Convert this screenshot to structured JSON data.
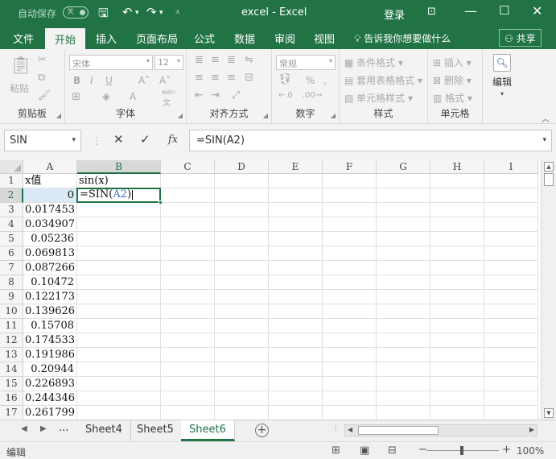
{
  "titlebar": {
    "autosave": "自动保存",
    "autosave_state": "关",
    "title": "excel  -  Excel",
    "login": "登录"
  },
  "tabs": [
    "文件",
    "开始",
    "插入",
    "页面布局",
    "公式",
    "数据",
    "审阅",
    "视图"
  ],
  "active_tab": "开始",
  "tellme": "告诉我你想要做什么",
  "share": "共享",
  "ribbon": {
    "clipboard": {
      "label": "剪贴板",
      "paste": "粘贴"
    },
    "font": {
      "label": "字体",
      "name": "宋体",
      "size": "12",
      "wen": "wén"
    },
    "alignment": {
      "label": "对齐方式"
    },
    "number": {
      "label": "数字",
      "format": "常规"
    },
    "styles": {
      "label": "样式",
      "items": [
        "条件格式",
        "套用表格格式",
        "单元格样式"
      ]
    },
    "cells": {
      "label": "单元格",
      "items": [
        "插入",
        "删除",
        "格式"
      ]
    },
    "editing": {
      "label": "编辑"
    }
  },
  "formula_bar": {
    "name_box": "SIN",
    "formula": "=SIN(A2)"
  },
  "columns": [
    "A",
    "B",
    "C",
    "D",
    "E",
    "F",
    "G",
    "H",
    "I"
  ],
  "rows": [
    {
      "n": "1",
      "a": "x值",
      "b": "sin(x)"
    },
    {
      "n": "2",
      "a": "0",
      "b": ""
    },
    {
      "n": "3",
      "a": "0.017453",
      "b": ""
    },
    {
      "n": "4",
      "a": "0.034907",
      "b": ""
    },
    {
      "n": "5",
      "a": "0.05236",
      "b": ""
    },
    {
      "n": "6",
      "a": "0.069813",
      "b": ""
    },
    {
      "n": "7",
      "a": "0.087266",
      "b": ""
    },
    {
      "n": "8",
      "a": "0.10472",
      "b": ""
    },
    {
      "n": "9",
      "a": "0.122173",
      "b": ""
    },
    {
      "n": "10",
      "a": "0.139626",
      "b": ""
    },
    {
      "n": "11",
      "a": "0.15708",
      "b": ""
    },
    {
      "n": "12",
      "a": "0.174533",
      "b": ""
    },
    {
      "n": "13",
      "a": "0.191986",
      "b": ""
    },
    {
      "n": "14",
      "a": "0.20944",
      "b": ""
    },
    {
      "n": "15",
      "a": "0.226893",
      "b": ""
    },
    {
      "n": "16",
      "a": "0.244346",
      "b": ""
    },
    {
      "n": "17",
      "a": "0.261799",
      "b": ""
    }
  ],
  "editing_cell": {
    "prefix": "=SIN(",
    "ref": "A2",
    "suffix": ")"
  },
  "sheets": [
    "Sheet4",
    "Sheet5",
    "Sheet6"
  ],
  "active_sheet": "Sheet6",
  "sheet_more": "...",
  "status": {
    "mode": "编辑",
    "zoom": "100%"
  },
  "colors": {
    "accent": "#217346",
    "ref_blue": "#3a6fc4",
    "selected_cell": "#dbe9f6"
  }
}
